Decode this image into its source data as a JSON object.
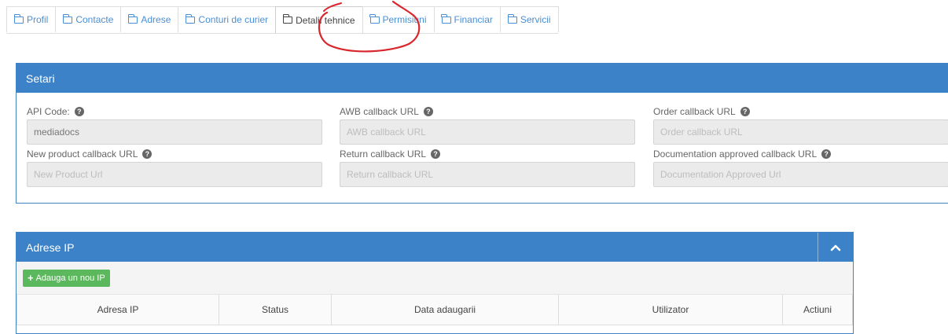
{
  "tabs": [
    {
      "label": "Profil",
      "active": false
    },
    {
      "label": "Contacte",
      "active": false
    },
    {
      "label": "Adrese",
      "active": false
    },
    {
      "label": "Conturi de curier",
      "active": false
    },
    {
      "label": "Detalii tehnice",
      "active": true
    },
    {
      "label": "Permisiuni",
      "active": false
    },
    {
      "label": "Financiar",
      "active": false
    },
    {
      "label": "Servicii",
      "active": false
    }
  ],
  "settings": {
    "title": "Setari",
    "fields": [
      {
        "label": "API Code:",
        "value": "mediadocs",
        "placeholder": ""
      },
      {
        "label": "AWB callback URL",
        "value": "",
        "placeholder": "AWB callback URL"
      },
      {
        "label": "Order callback URL",
        "value": "",
        "placeholder": "Order callback URL"
      },
      {
        "label": "New product callback URL",
        "value": "",
        "placeholder": "New Product Url"
      },
      {
        "label": "Return callback URL",
        "value": "",
        "placeholder": "Return callback URL"
      },
      {
        "label": "Documentation approved callback URL",
        "value": "",
        "placeholder": "Documentation Approved Url"
      }
    ]
  },
  "ip_panel": {
    "title": "Adrese IP",
    "add_button": "Adauga un nou IP",
    "columns": [
      "Adresa IP",
      "Status",
      "Data adaugarii",
      "Utilizator",
      "Actiuni"
    ]
  },
  "colors": {
    "panel_header": "#3c82c8",
    "tab_link": "#4a8fd4",
    "add_button": "#5cb85c",
    "annotation": "#d9262c"
  },
  "icons": {
    "tab": "folder-icon",
    "help": "question-circle-icon",
    "collapse": "chevron-up-icon",
    "add": "plus-icon"
  }
}
